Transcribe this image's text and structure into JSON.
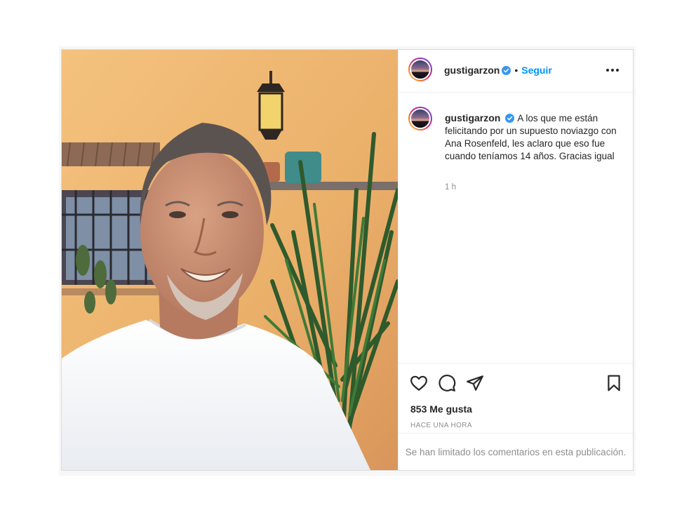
{
  "post": {
    "username": "gustigarzon",
    "follow_label": "Seguir",
    "separator": "•",
    "caption": "A los que me están felicitando por un supuesto noviazgo con Ana Rosenfeld, les aclaro que eso fue cuando teníamos 14 años. Gracias igual",
    "caption_time": "1 h",
    "likes": "853 Me gusta",
    "posted_ago": "HACE UNA HORA",
    "comments_limited": "Se han limitado los comentarios en esta publicación."
  },
  "icons": {
    "verified": "verified-badge-icon",
    "more": "more-options-icon",
    "like": "heart-icon",
    "comment": "comment-icon",
    "share": "share-paper-plane-icon",
    "save": "bookmark-icon"
  },
  "colors": {
    "accent": "#0095f6",
    "text": "#262626",
    "muted": "#8e8e8e",
    "border": "#dbdbdb"
  }
}
